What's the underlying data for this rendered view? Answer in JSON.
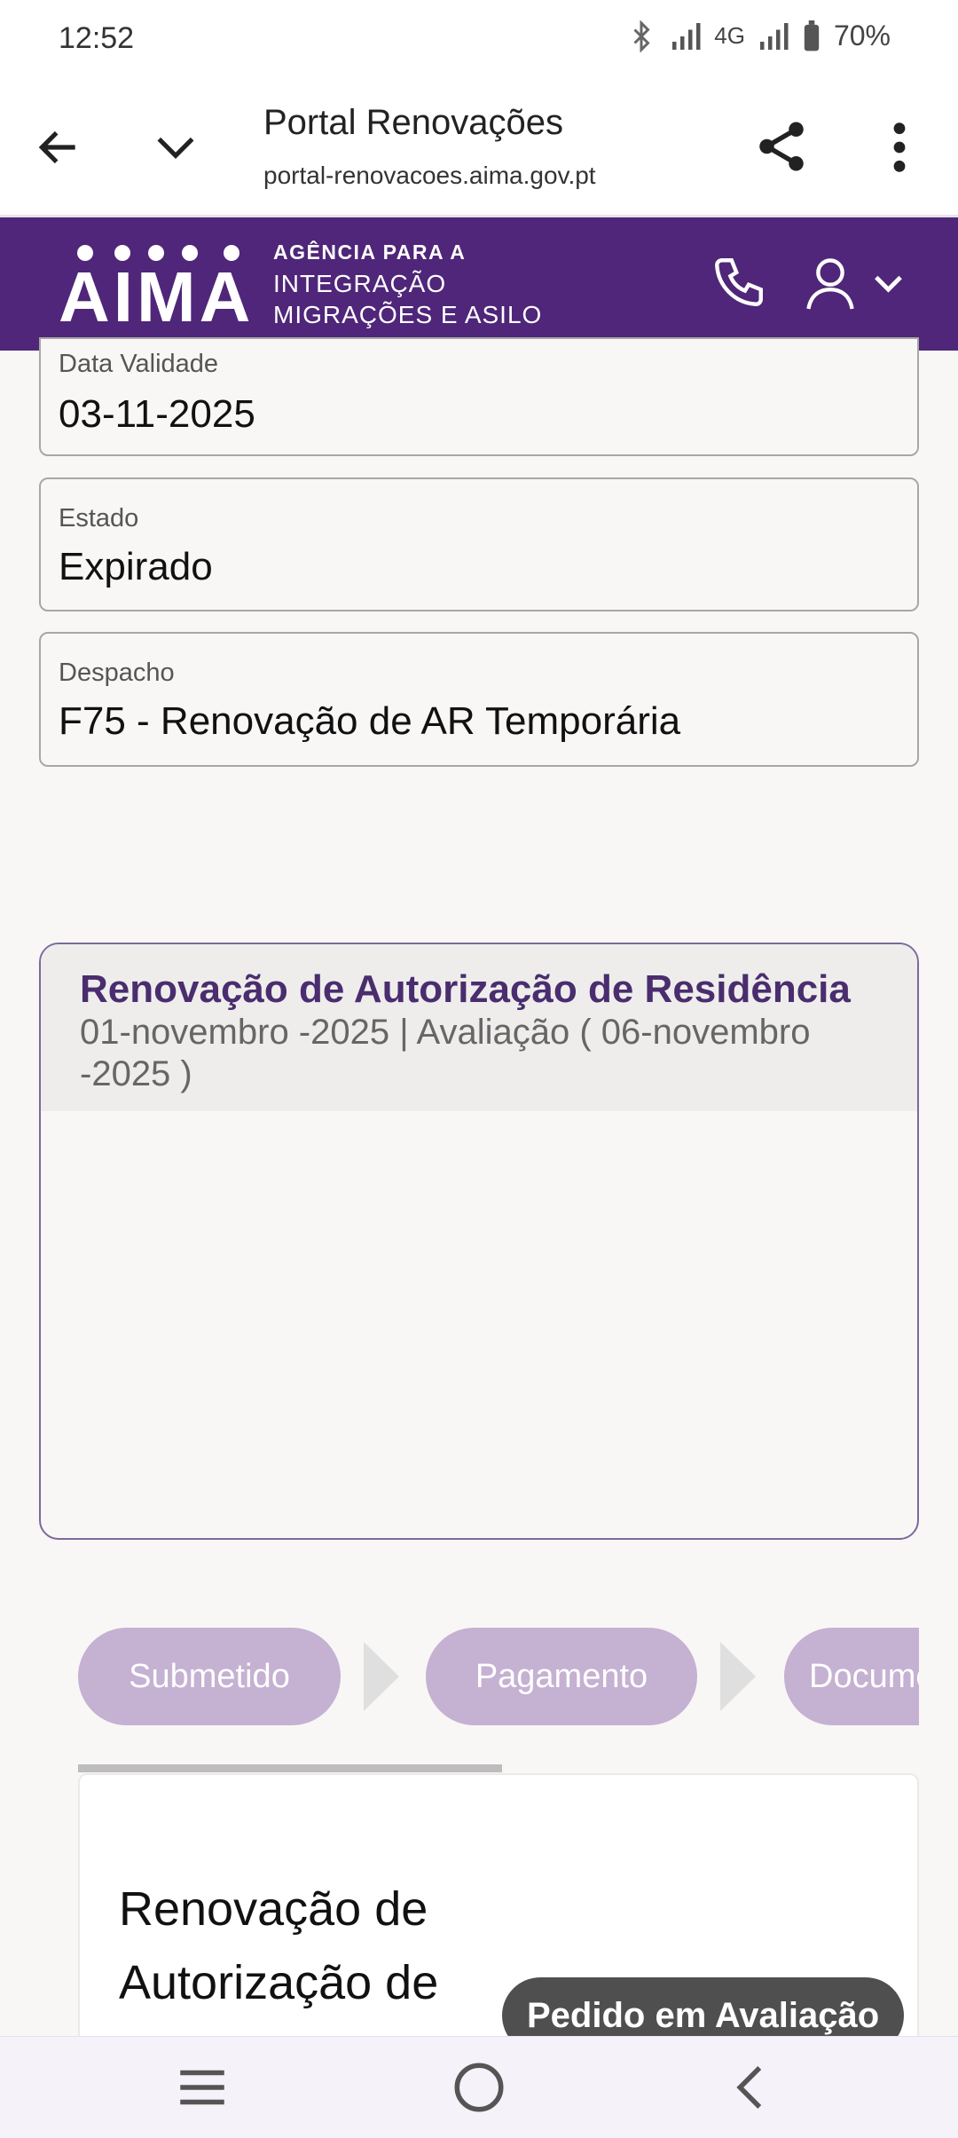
{
  "status_bar": {
    "time": "12:52",
    "network": "4G",
    "battery": "70%"
  },
  "browser": {
    "title": "Portal Renovações",
    "url": "portal-renovacoes.aima.gov.pt"
  },
  "header": {
    "logo_text": "AIMA",
    "tagline": [
      "AGÊNCIA PARA A",
      "INTEGRAÇÃO",
      "MIGRAÇÕES E ASILO"
    ],
    "brand_color": "#4f2679"
  },
  "fields": [
    {
      "label": "Data Validade",
      "value": "03-11-2025"
    },
    {
      "label": "Estado",
      "value": "Expirado"
    },
    {
      "label": "Despacho",
      "value": "F75 - Renovação de AR Temporária"
    }
  ],
  "renewal_card": {
    "title": "Renovação de Autorização de Residência",
    "subtitle": "01-novembro -2025 | Avaliação ( 06-novembro -2025 )"
  },
  "steps": [
    "Submetido",
    "Pagamento",
    "Documentos"
  ],
  "detail": {
    "title": "Renovação de Autorização de Residência",
    "status": "Pedido em Avaliação"
  },
  "icons": [
    "back-icon",
    "chevron-down-icon",
    "share-icon",
    "more-vert-icon",
    "phone-icon",
    "user-icon",
    "menu-icon",
    "home-icon",
    "back-nav-icon"
  ]
}
